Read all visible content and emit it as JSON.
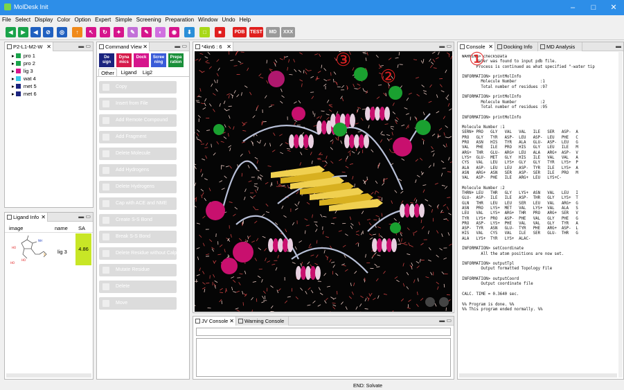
{
  "window": {
    "title": "MolDesk Init",
    "min": "–",
    "max": "□",
    "close": "✕"
  },
  "menu": [
    "File",
    "Select",
    "Display",
    "Color",
    "Option",
    "Expert",
    "Simple",
    "Screening",
    "Preparation",
    "Window",
    "Undo",
    "Help"
  ],
  "toolbar": {
    "buttons": [
      {
        "icon": "arrow-left-icon",
        "glyph": "◀",
        "color": "#1aa34a"
      },
      {
        "icon": "arrow-right-icon",
        "glyph": "▶",
        "color": "#1aa34a"
      },
      {
        "icon": "arrow-back-icon",
        "glyph": "◀",
        "color": "#2060c0"
      },
      {
        "icon": "no-icon",
        "glyph": "⊘",
        "color": "#2060c0"
      },
      {
        "icon": "target-icon",
        "glyph": "◎",
        "color": "#2060c0"
      },
      {
        "icon": "hand-icon",
        "glyph": "↑",
        "color": "#f08a1a"
      },
      {
        "icon": "pointer-icon",
        "glyph": "↖",
        "color": "#d6158c"
      },
      {
        "icon": "rotate-icon",
        "glyph": "↻",
        "color": "#d6158c"
      },
      {
        "icon": "magic-icon",
        "glyph": "✦",
        "color": "#d6158c"
      },
      {
        "icon": "pen-icon",
        "glyph": "✎",
        "color": "#c270d8"
      },
      {
        "icon": "brush-icon",
        "glyph": "✎",
        "color": "#d6158c"
      },
      {
        "icon": "paint-icon",
        "glyph": "◐",
        "color": "#d070e0"
      },
      {
        "icon": "eye-icon",
        "glyph": "◉",
        "color": "#d6158c"
      },
      {
        "icon": "download-icon",
        "glyph": "⬇",
        "color": "#2b8fd8"
      },
      {
        "icon": "monitor-icon",
        "glyph": "□",
        "color": "#a8d818"
      },
      {
        "icon": "stop-icon",
        "glyph": "■",
        "color": "#e02020"
      }
    ],
    "text_buttons": [
      {
        "label": "PDB",
        "color": "#e0201e"
      },
      {
        "label": "TEST",
        "color": "#e0201e"
      },
      {
        "label": "MD",
        "color": "#9a9a9a"
      },
      {
        "label": "XXX",
        "color": "#9a9a9a"
      }
    ]
  },
  "project_panel": {
    "tab": "P2-L1-M2-W",
    "items": [
      {
        "label": "pro 1",
        "color": "#1aa34a"
      },
      {
        "label": "pro 2",
        "color": "#1aa34a"
      },
      {
        "label": "lig 3",
        "color": "#d6158c"
      },
      {
        "label": "wat 4",
        "color": "#3ac8e8"
      },
      {
        "label": "met 5",
        "color": "#1a237e"
      },
      {
        "label": "met 6",
        "color": "#1a237e"
      }
    ]
  },
  "ligand_panel": {
    "tab": "Ligand Info",
    "columns": [
      "image",
      "name",
      "SA"
    ],
    "row": {
      "name": "lig 3",
      "sa": "4.86"
    }
  },
  "command_view": {
    "tab": "Command View",
    "mode_buttons": [
      {
        "label": "De\nsign",
        "color": "#1a237e"
      },
      {
        "label": "Dyna\nmics",
        "color": "#d61a4a"
      },
      {
        "label": "Dock",
        "color": "#d6158c"
      },
      {
        "label": "Scree\nning",
        "color": "#3a5cd8"
      },
      {
        "label": "Prepa\nration",
        "color": "#1a8f3a"
      }
    ],
    "subtabs": [
      "Other",
      "Ligand",
      "Lig2"
    ],
    "commands": [
      "Copy",
      "Insert from File",
      "Add Remote Compound",
      "Add Fragment",
      "Delete Molecule",
      "Add Hydrogens",
      "Delete Hydrogens",
      "Cap with ACE and NME",
      "Create S-S Bond",
      "Break S-S Bond",
      "Delete Residue without Calpha",
      "Mutate Residue",
      "Delete",
      "Move"
    ]
  },
  "viewer": {
    "tab": "*4kn6 : 6",
    "marker_3": "③",
    "marker_2": "②"
  },
  "jv_console": {
    "tab": "JV Console",
    "tab2": "Warning Console"
  },
  "right_panel": {
    "tabs": [
      "Console",
      "Docking Info",
      "MD Analysis"
    ],
    "lines": [
      "WARNING> checkSData",
      "      Water was found to input pdb file.",
      "      Process is continued as what specified \"-water tip",
      "",
      "INFORMATION> printMolInfo",
      "        Molecule Number          :1",
      "        Total number of residues :97",
      "",
      "INFORMATION> printMolInfo",
      "        Molecule Number          :2",
      "        Total number of residues :95",
      "",
      "INFORMATION> printMolInfo",
      "",
      "Molecule Number :1",
      "SERN+ PRO   GLY   VAL   VAL   ILE   SER   ASP-  A",
      "PRO   GLY   TYR   ASP-  LEU   ASP-  LEU   PHE   C",
      "PRO   ASN   HIS   TYR   ALA   GLU-  ASP-  LEU   G",
      "VAL   PHE   ILE   PRO   HIS   GLY   LEU   ILE   M",
      "ARG+  THR   GLU-  ARG+  LEU   ALA   ARG+  ASP-  V",
      "LYS+  GLU-  MET   GLY   HIS   ILE   VAL   VAL   A",
      "CYS   VAL   LEU   LYS+  GLY   GLY   TYR   LYS+  P",
      "ALA   ASP-  LEU   LEU   ASP-  TYR   ILE   LYS+  A",
      "ASN   ARG+  ASN   SER   ASP-  SER   ILE   PRO   M",
      "VAL   ASP-  PHE   ILE   ARG+  LEU   LYS+C-",
      "",
      "Molecule Number :2",
      "THRN+ LEU   THR   GLY   LYS+  ASN   VAL   LEU   I",
      "GLU-  ASP-  ILE   ILE   ASP-  THR   GLY   LYS+  T",
      "GLN   THR   LEU   LEU   SER   LEU   VAL   ARG+  G",
      "ASN   PRO   LYS+  MET   VAL   LYS+  VAL   ALA   S",
      "LEU   VAL   LYS+  ARG+  THR   PRO   ARG+  SER   V",
      "TYR   LYS+  PRO   ASP-  PHE   VAL   GLY   PHE   G",
      "PRO   ASP-  LYS+  PHE   VAL   VAL   GLY   TYR   A",
      "ASP-  TYR   ASN   GLU-  TYR   PHE   ARG+  ASP-  L",
      "HIS   VAL   CYS   VAL   ILE   SER   GLU-  THR   G",
      "ALA   LYS+  TYR   LYS+  ALAC-",
      "",
      "INFORMATION> setCoordinate",
      "        All the atom positions are now set.",
      "",
      "INFORMATION> outputTpl",
      "        Output formatted Topology File",
      "",
      "INFORMATION> outputCoord",
      "        Output coordinate file",
      "",
      "CALC. TIME = 0.3640 sec.",
      "",
      "%% Program is done. %%",
      "%% This program ended normally. %%"
    ],
    "marker_1": "①"
  },
  "status": "END: Solvate"
}
